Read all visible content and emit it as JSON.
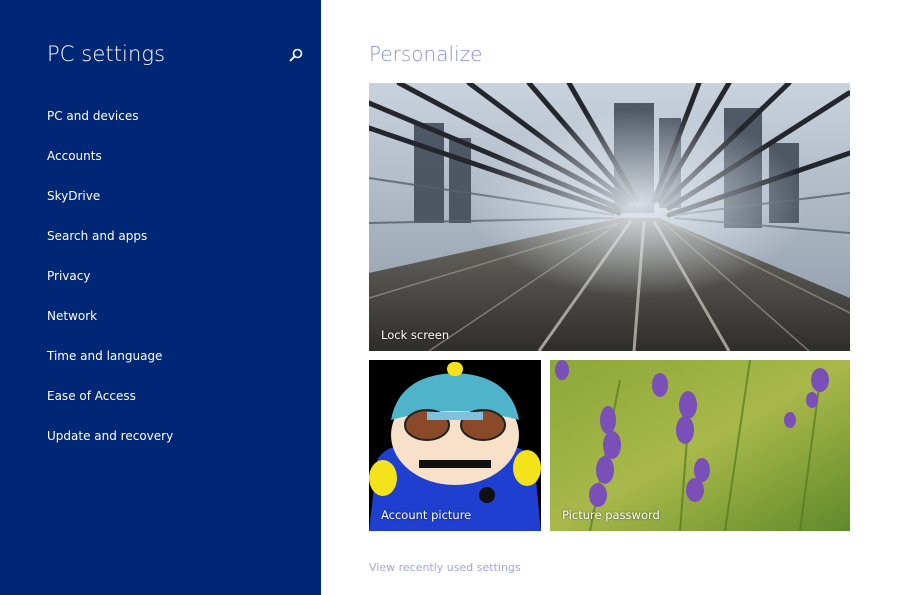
{
  "sidebar": {
    "title": "PC settings",
    "search_icon": "search-icon",
    "items": [
      {
        "label": "PC and devices"
      },
      {
        "label": "Accounts"
      },
      {
        "label": "SkyDrive"
      },
      {
        "label": "Search and apps"
      },
      {
        "label": "Privacy"
      },
      {
        "label": "Network"
      },
      {
        "label": "Time and language"
      },
      {
        "label": "Ease of Access"
      },
      {
        "label": "Update and recovery"
      }
    ]
  },
  "main": {
    "title": "Personalize",
    "tiles": {
      "lock_screen": "Lock screen",
      "account_picture": "Account picture",
      "picture_password": "Picture password"
    },
    "recent_link": "View recently used settings"
  },
  "colors": {
    "sidebar_bg": "#002775",
    "accent_title": "#8a8fd8",
    "link": "#9fa6dc"
  }
}
